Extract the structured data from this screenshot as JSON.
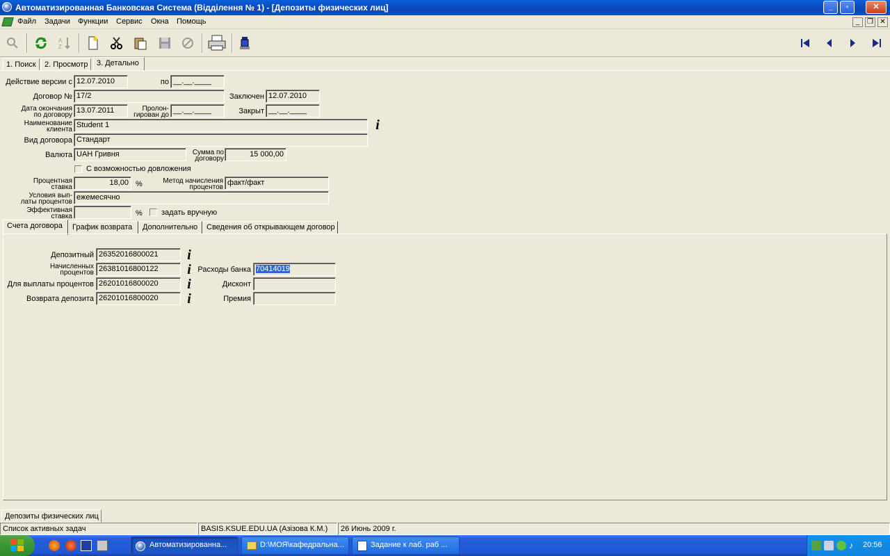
{
  "window": {
    "title": "Автоматизированная Банковская Система (Відділення № 1) - [Депозиты физических лиц]"
  },
  "menu": [
    "Файл",
    "Задачи",
    "Функции",
    "Сервис",
    "Окна",
    "Помощь"
  ],
  "tabs": [
    "1. Поиск",
    "2. Просмотр",
    "3. Детально"
  ],
  "form": {
    "version_from_label": "Действие версии с",
    "version_from": "12.07.2010",
    "version_to_label": "по",
    "version_to": "__.__.____",
    "contract_label": "Договор №",
    "contract": "17/2",
    "concluded_label": "Заключен",
    "concluded": "12.07.2010",
    "end_date_label_1": "Дата окончания",
    "end_date_label_2": "по договору",
    "end_date": "13.07.2011",
    "prolong_label_1": "Пролон-",
    "prolong_label_2": "гирован до",
    "prolong": "__.__.____",
    "closed_label": "Закрыт",
    "closed": "__.__.____",
    "client_label_1": "Наименование",
    "client_label_2": "клиента",
    "client": "Student 1",
    "contract_type_label": "Вид договора",
    "contract_type": "Стандарт",
    "currency_label": "Валюта",
    "currency": "UAH Гривня",
    "amount_label_1": "Сумма по",
    "amount_label_2": "договору",
    "amount": "15 000,00",
    "topup_label": "С возможностью довложения",
    "rate_label_1": "Процентная",
    "rate_label_2": "ставка",
    "rate": "18,00",
    "percent_sign": "%",
    "method_label_1": "Метод начисления",
    "method_label_2": "процентов",
    "method": "факт/факт",
    "payout_label_1": "Условия вып-",
    "payout_label_2": "латы процентов",
    "payout": "ежемесячно",
    "eff_rate_label_1": "Эффективная",
    "eff_rate_label_2": "ставка",
    "eff_rate": "",
    "manual_label": "задать вручную"
  },
  "subtabs": [
    "Счета договора",
    "График возврата",
    "Дополнительно",
    "Сведения об открывающем договор"
  ],
  "accounts": {
    "deposit_label": "Депозитный",
    "deposit": "26352016800021",
    "accrued_label_1": "Начисленных",
    "accrued_label_2": "процентов",
    "accrued": "26381016800122",
    "payout_label": "Для выплаты процентов",
    "payout": "26201016800020",
    "return_label": "Возврата депозита",
    "return": "26201016800020",
    "bank_exp_label": "Расходы банка",
    "bank_exp": "70414019",
    "discount_label": "Дисконт",
    "discount": "",
    "premium_label": "Премия",
    "premium": ""
  },
  "info_glyph": "i",
  "bottom_tab": "Депозиты физических лиц",
  "status": {
    "tasks": "Список активных задач",
    "server": "BASIS.KSUE.EDU.UA (Азізова К.М.)",
    "date": "26 Июнь 2009 г."
  },
  "taskbar": {
    "items": [
      "Автоматизированна...",
      "D:\\МОЯ\\кафедральна...",
      "Задание к лаб. раб ..."
    ],
    "clock": "20:56"
  },
  "colors": {
    "titlebar": "#0a4fc8",
    "face": "#ece9d8",
    "taskbar": "#245edb",
    "selection": "#316ac5"
  }
}
